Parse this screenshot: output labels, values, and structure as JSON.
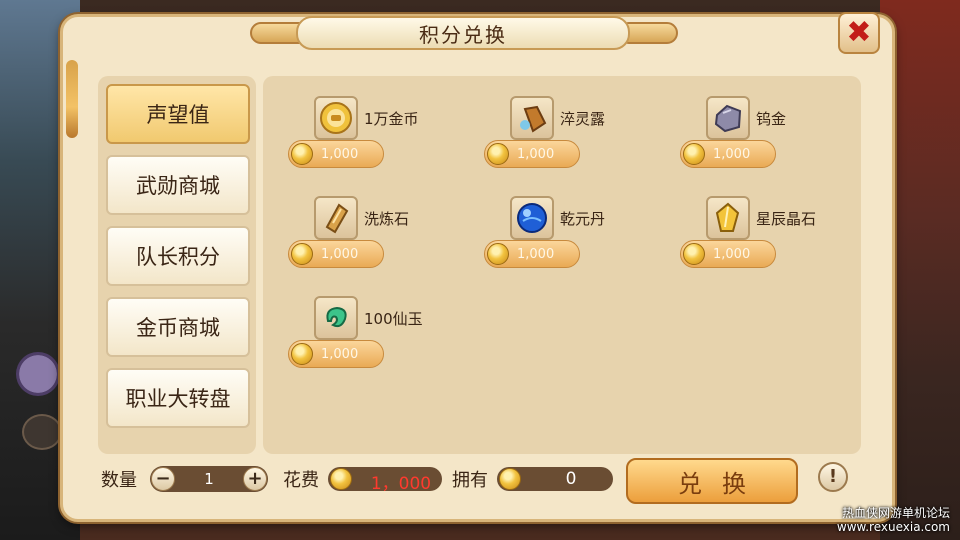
{
  "title": "积分兑换",
  "close_icon": "close-x-icon",
  "categories": [
    {
      "label": "声望值",
      "active": true
    },
    {
      "label": "武勋商城",
      "active": false
    },
    {
      "label": "队长积分",
      "active": false
    },
    {
      "label": "金币商城",
      "active": false
    },
    {
      "label": "职业大转盘",
      "active": false
    }
  ],
  "items": [
    {
      "name": "1万金币",
      "price": "1,000",
      "icon": "gold-coin-icon"
    },
    {
      "name": "淬灵露",
      "price": "1,000",
      "icon": "potion-jar-icon"
    },
    {
      "name": "钨金",
      "price": "1,000",
      "icon": "ore-stone-icon"
    },
    {
      "name": "洗炼石",
      "price": "1,000",
      "icon": "refining-crystal-icon"
    },
    {
      "name": "乾元丹",
      "price": "1,000",
      "icon": "blue-pill-icon"
    },
    {
      "name": "星辰晶石",
      "price": "1,000",
      "icon": "star-crystal-icon"
    },
    {
      "name": "100仙玉",
      "price": "1,000",
      "icon": "jade-icon"
    }
  ],
  "footer": {
    "qty_label": "数量",
    "qty_value": "1",
    "minus": "−",
    "plus": "+",
    "cost_label": "花费",
    "cost_value": "1，000",
    "own_label": "拥有",
    "own_value": "0",
    "exchange_label": "兑换",
    "info": "!"
  },
  "watermark": {
    "line1": "热血侠网游单机论坛",
    "line2": "www.rexuexia.com"
  },
  "colors": {
    "panel": "#f4e6c8",
    "active_tab": "#f1c96f",
    "cost_text": "#ff3a2e",
    "close": "#c21d18"
  }
}
